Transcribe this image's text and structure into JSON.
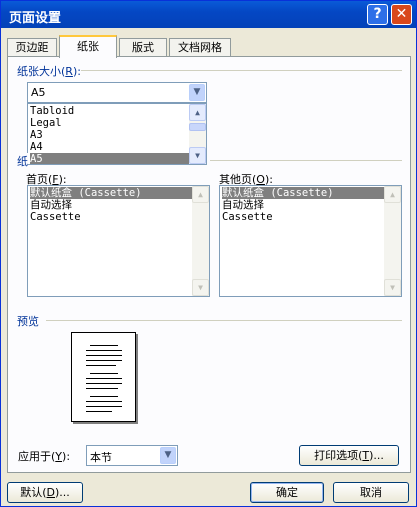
{
  "window": {
    "title": "页面设置",
    "help_label": "?",
    "close_label": "✕"
  },
  "tabs": [
    {
      "label": "页边距"
    },
    {
      "label": "纸张"
    },
    {
      "label": "版式"
    },
    {
      "label": "文档网格"
    }
  ],
  "paper_size": {
    "label": "纸张大小",
    "hotkey": "R",
    "value": "A5",
    "dropdown_items": [
      "Tabloid",
      "Legal",
      "A3",
      "A4",
      "A5"
    ],
    "selected_index": 4
  },
  "paper_source": {
    "partial_label": "纸",
    "first_page": {
      "label": "首页",
      "hotkey": "F",
      "items": [
        "默认纸盒 (Cassette)",
        "自动选择",
        "Cassette"
      ],
      "selected_index": 0
    },
    "other_pages": {
      "label": "其他页",
      "hotkey": "O",
      "items": [
        "默认纸盒 (Cassette)",
        "自动选择",
        "Cassette"
      ],
      "selected_index": 0
    }
  },
  "preview": {
    "label": "预览"
  },
  "apply_to": {
    "label": "应用于",
    "hotkey": "Y",
    "value": "本节"
  },
  "buttons": {
    "print_options": "打印选项",
    "print_options_hotkey": "T",
    "default": "默认",
    "default_hotkey": "D",
    "ok": "确定",
    "cancel": "取消"
  }
}
